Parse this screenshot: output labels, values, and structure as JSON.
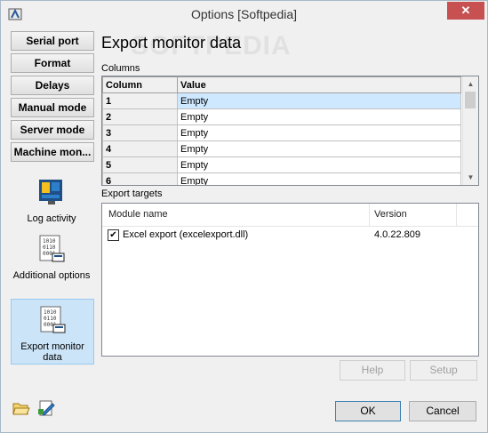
{
  "window": {
    "title": "Options [Softpedia]",
    "close_label": "✕",
    "watermark": "SOFTPEDIA"
  },
  "nav": {
    "buttons": [
      "Serial port",
      "Format",
      "Delays",
      "Manual mode",
      "Server mode",
      "Machine mon..."
    ],
    "tools": [
      {
        "label": "Log activity",
        "icon": "log-activity-icon"
      },
      {
        "label": "Additional options",
        "icon": "binary-document-icon"
      },
      {
        "label": "Export monitor data",
        "icon": "binary-document-icon",
        "selected": true
      }
    ]
  },
  "page": {
    "heading": "Export monitor data",
    "columns_label": "Columns",
    "columns_grid": {
      "headers": [
        "Column",
        "Value"
      ],
      "rows": [
        {
          "col": "1",
          "val": "Empty"
        },
        {
          "col": "2",
          "val": "Empty"
        },
        {
          "col": "3",
          "val": "Empty"
        },
        {
          "col": "4",
          "val": "Empty"
        },
        {
          "col": "5",
          "val": "Empty"
        },
        {
          "col": "6",
          "val": "Empty"
        }
      ]
    },
    "targets_label": "Export targets",
    "targets_list": {
      "headers": [
        "Module name",
        "Version"
      ],
      "rows": [
        {
          "checked": true,
          "name": "Excel export (excelexport.dll)",
          "version": "4.0.22.809"
        }
      ]
    },
    "help_label": "Help",
    "setup_label": "Setup"
  },
  "footer": {
    "ok_label": "OK",
    "cancel_label": "Cancel",
    "icons": [
      "open-folder-icon",
      "edit-document-icon"
    ]
  },
  "colors": {
    "selection": "#cce4f7",
    "close_button": "#c75050",
    "window_bg": "#f0f0f0"
  }
}
